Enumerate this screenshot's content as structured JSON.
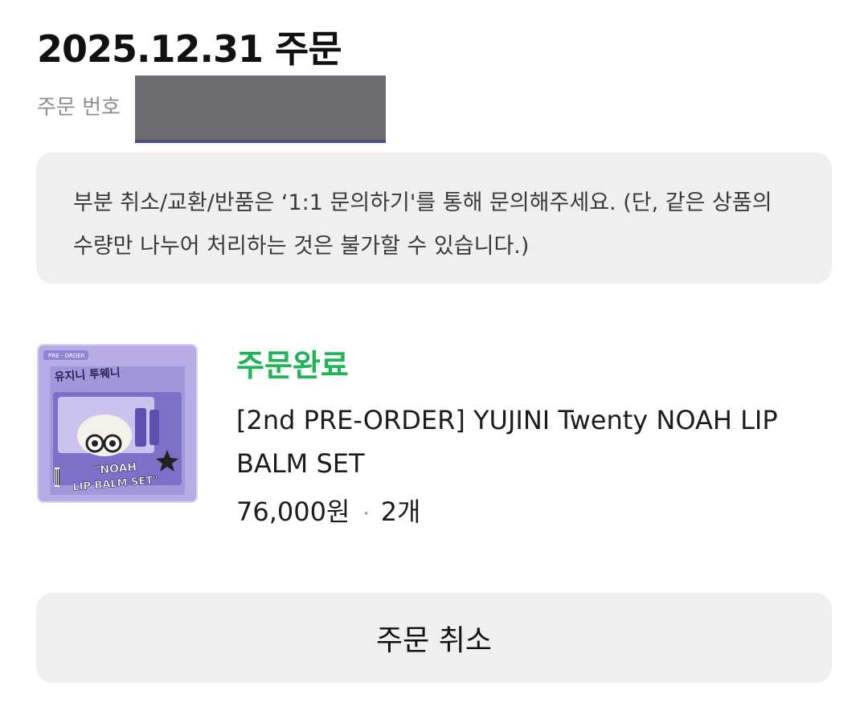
{
  "order": {
    "title": "2025.12.31 주문",
    "number_label": "주문 번호"
  },
  "notice": {
    "text": "부분 취소/교환/반품은 ‘1:1 문의하기'를 통해 문의해주세요. (단, 같은 상품의 수량만 나누어 처리하는 것은 불가할 수 있습니다.)"
  },
  "product": {
    "status": "주문완료",
    "status_color": "#1fb456",
    "name": "[2nd PRE-ORDER] YUJINI Twenty NOAH LIP BALM SET",
    "price": "76,000원",
    "separator": "·",
    "quantity": "2개",
    "thumbnail": {
      "badge": "PRE - ORDER",
      "logo_text": "유지니 투웨니",
      "box_text_line1": "\"NOAH",
      "box_text_line2": "LIP BALM SET\""
    }
  },
  "actions": {
    "cancel_label": "주문 취소"
  }
}
